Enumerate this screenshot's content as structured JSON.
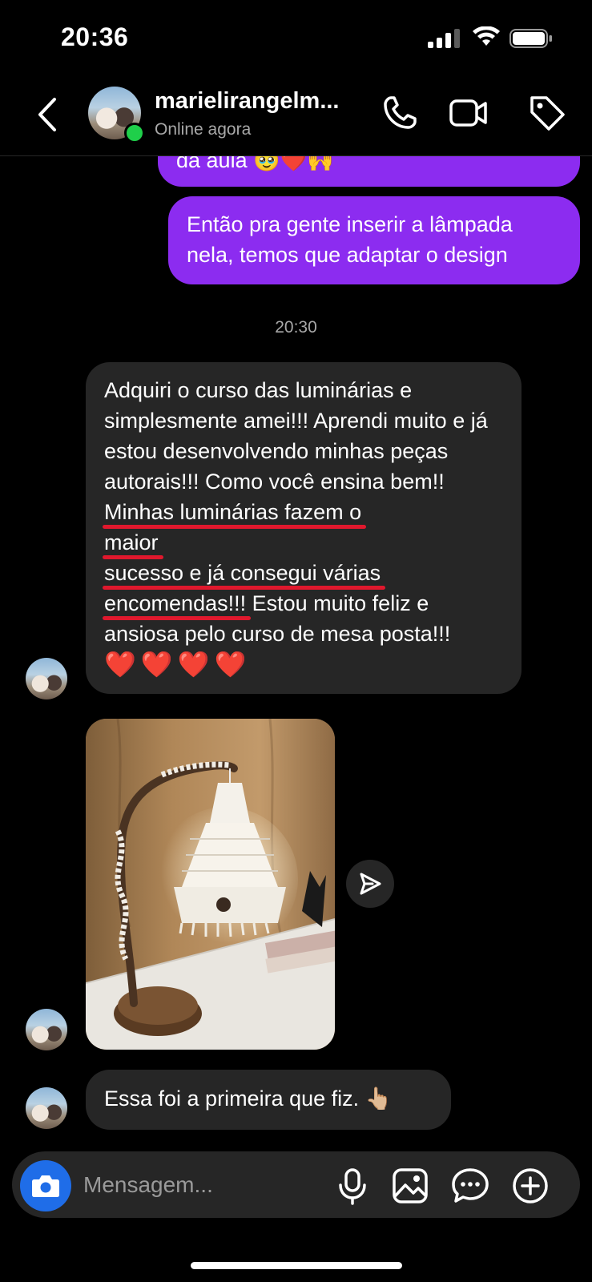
{
  "status_bar": {
    "time": "20:36"
  },
  "header": {
    "contact_name": "marielirangelm...",
    "status": "Online agora"
  },
  "messages": {
    "partial_out": "da aula 🥹❤️🙌",
    "out_1": "Então pra gente inserir a lâmpada nela, temos que adaptar o design",
    "timestamp": "20:30",
    "in_1": {
      "p1": "Adquiri o curso das luminárias e simplesmente amei!!! Aprendi muito e já estou desenvolvendo minhas peças autorais!!! Como você ensina bem!! ",
      "u1a": "Minhas luminárias fazem o",
      "u1b": "maior",
      "u2a": "sucesso e já consegui várias",
      "u2b": "encomendas!!!",
      "p2": " Estou muito feliz e ansiosa pelo curso de mesa posta!!!",
      "hearts": "❤️❤️❤️❤️"
    },
    "in_2": "Essa foi a primeira que fiz. 👆🏼"
  },
  "composer": {
    "placeholder": "Mensagem..."
  },
  "icons": {
    "back": "chevron-left-icon",
    "call": "phone-icon",
    "video": "video-icon",
    "tag": "tag-icon",
    "share": "send-icon",
    "camera": "camera-icon",
    "mic": "microphone-icon",
    "gallery": "image-icon",
    "sticker": "chat-bubble-icon",
    "plus": "plus-circle-icon"
  },
  "colors": {
    "outgoing_bubble": "#8c2cf0",
    "incoming_bubble": "#262626",
    "online": "#1fcf4a",
    "underline": "#e0182d",
    "camera_button": "#1f6de8"
  }
}
